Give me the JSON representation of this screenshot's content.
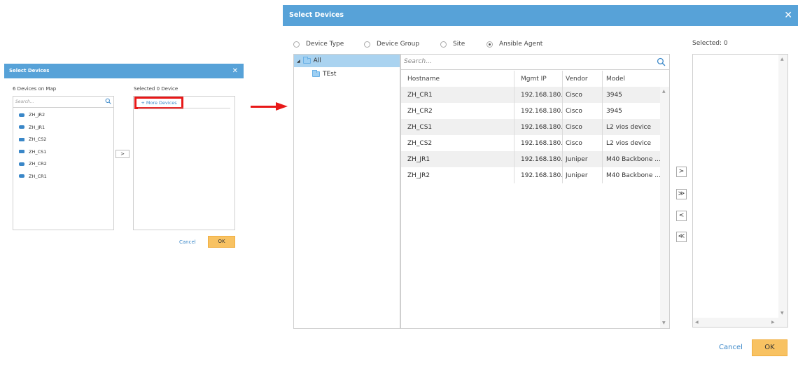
{
  "small_dialog": {
    "title": "Select Devices",
    "close": "✕",
    "left_label": "6 Devices on Map",
    "search_placeholder": "Search...",
    "devices": [
      {
        "name": "ZH_JR2",
        "icon": "router-icon"
      },
      {
        "name": "ZH_JR1",
        "icon": "router-icon"
      },
      {
        "name": "ZH_CS2",
        "icon": "switch-icon"
      },
      {
        "name": "ZH_CS1",
        "icon": "switch-icon"
      },
      {
        "name": "ZH_CR2",
        "icon": "router-icon"
      },
      {
        "name": "ZH_CR1",
        "icon": "router-icon"
      }
    ],
    "move_button": ">",
    "right_label": "Selected 0 Device",
    "more_devices": "+ More Devices",
    "cancel": "Cancel",
    "ok": "OK"
  },
  "large_dialog": {
    "title": "Select Devices",
    "close": "✕",
    "radios": [
      {
        "label": "Device Type",
        "checked": false
      },
      {
        "label": "Device Group",
        "checked": false
      },
      {
        "label": "Site",
        "checked": false
      },
      {
        "label": "Ansible Agent",
        "checked": true
      }
    ],
    "tree": {
      "root": "All",
      "child": "TEst"
    },
    "search_placeholder": "Search...",
    "columns": [
      "Hostname",
      "Mgmt IP",
      "Vendor",
      "Model"
    ],
    "rows": [
      [
        "ZH_CR1",
        "192.168.180...",
        "Cisco",
        "3945"
      ],
      [
        "ZH_CR2",
        "192.168.180...",
        "Cisco",
        "3945"
      ],
      [
        "ZH_CS1",
        "192.168.180...",
        "Cisco",
        "L2 vios device"
      ],
      [
        "ZH_CS2",
        "192.168.180...",
        "Cisco",
        "L2 vios device"
      ],
      [
        "ZH_JR1",
        "192.168.180...",
        "Juniper",
        "M40 Backbone ..."
      ],
      [
        "ZH_JR2",
        "192.168.180...",
        "Juniper",
        "M40 Backbone ..."
      ]
    ],
    "move_buttons": [
      ">",
      "≫",
      "<",
      "≪"
    ],
    "selected_label": "Selected: 0",
    "cancel": "Cancel",
    "ok": "OK"
  },
  "colors": {
    "title_bar": "#57a2d8",
    "accent_link": "#3a87c8",
    "ok_button": "#f8c262",
    "highlight": "#e81818",
    "tree_selected": "#aad3f0"
  }
}
